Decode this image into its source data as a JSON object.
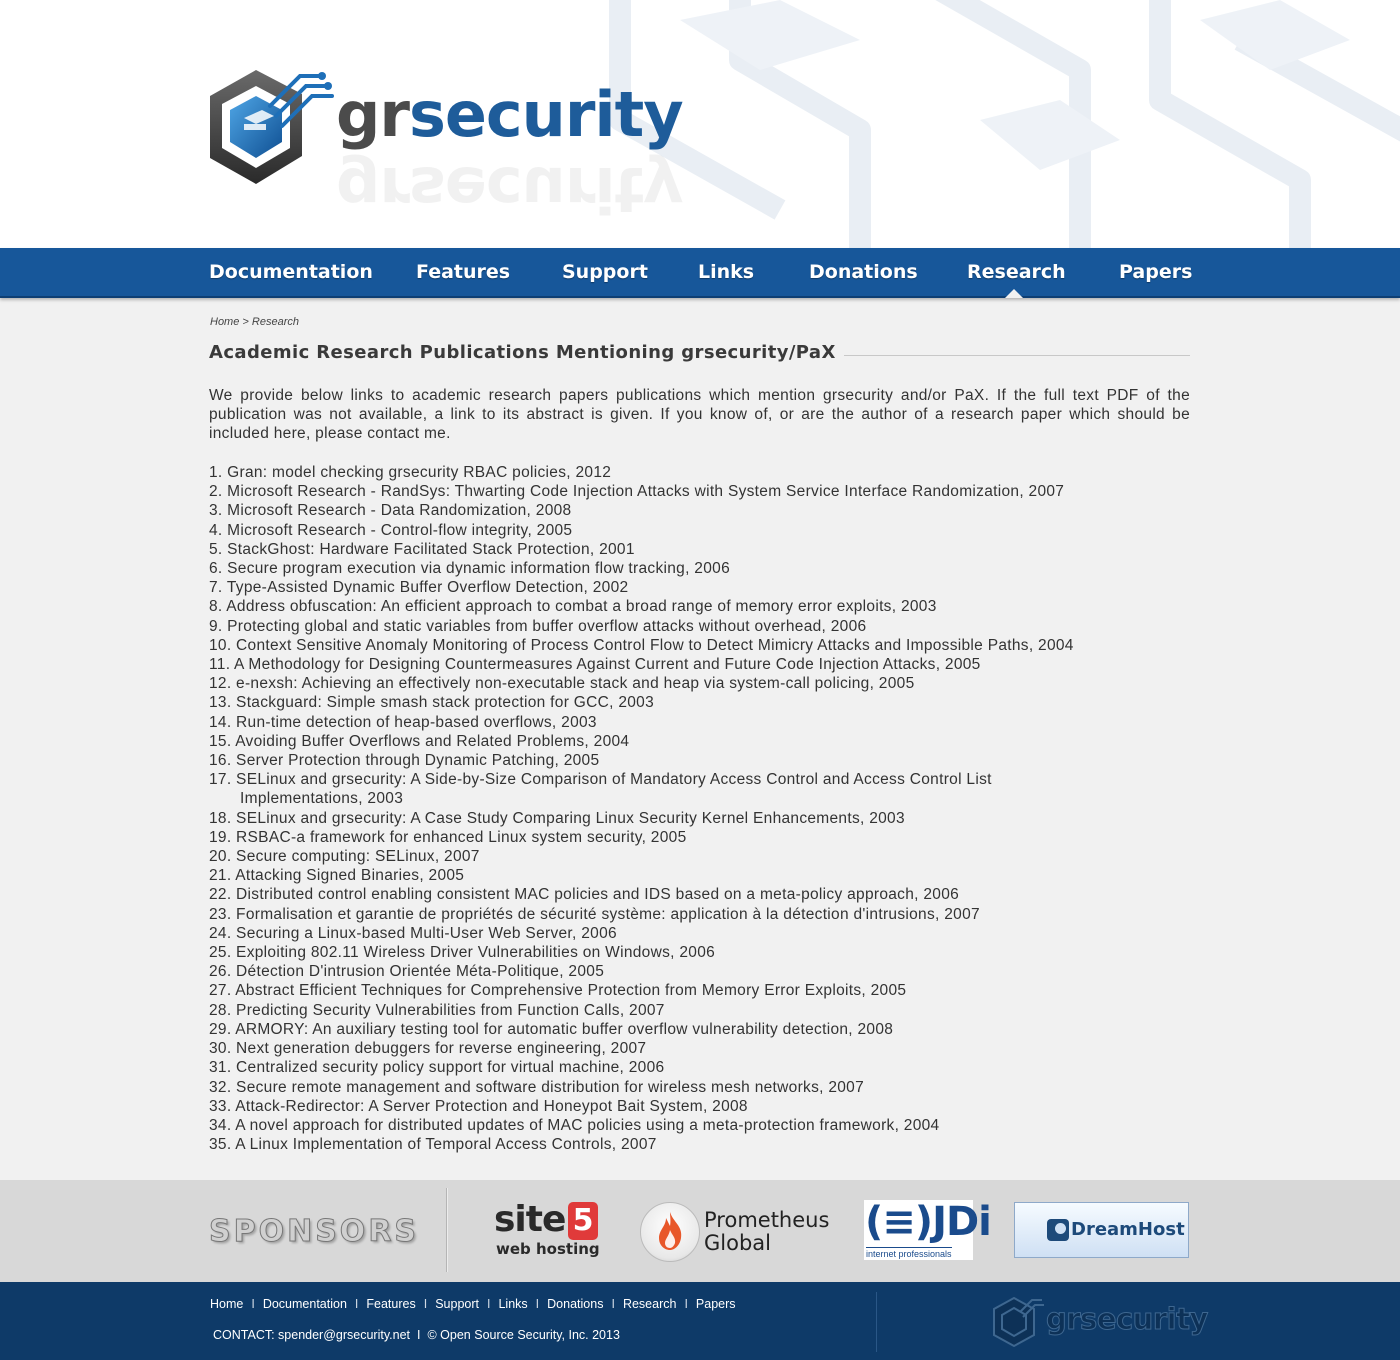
{
  "brand": {
    "name_part1": "gr",
    "name_part2": "security"
  },
  "nav": {
    "items": [
      {
        "label": "Documentation",
        "active": false
      },
      {
        "label": "Features",
        "active": false
      },
      {
        "label": "Support",
        "active": false
      },
      {
        "label": "Links",
        "active": false
      },
      {
        "label": "Donations",
        "active": false
      },
      {
        "label": "Research",
        "active": true
      },
      {
        "label": "Papers",
        "active": false
      }
    ]
  },
  "breadcrumb": {
    "home": "Home",
    "separator": ">",
    "current": "Research"
  },
  "page": {
    "title": "Academic Research Publications Mentioning grsecurity/PaX",
    "intro": "We provide below links to academic research papers publications which mention grsecurity and/or PaX. If the full text PDF of the publication was not available, a link to its abstract is given. If you know of, or are the author of a research paper which should be included here, please contact me."
  },
  "publications": [
    "1. Gran: model checking grsecurity RBAC policies, 2012",
    "2. Microsoft Research - RandSys: Thwarting Code Injection Attacks with System Service Interface Randomization, 2007",
    "3. Microsoft Research - Data Randomization, 2008",
    "4. Microsoft Research - Control-flow integrity, 2005",
    "5. StackGhost: Hardware Facilitated Stack Protection, 2001",
    "6. Secure program execution via dynamic information flow tracking, 2006",
    "7. Type-Assisted Dynamic Buffer Overflow Detection, 2002",
    "8. Address obfuscation: An efficient approach to combat a broad range of memory error exploits, 2003",
    "9. Protecting global and static variables from buffer overflow attacks without overhead, 2006",
    "10. Context Sensitive Anomaly Monitoring of Process Control Flow to Detect Mimicry Attacks and Impossible Paths, 2004",
    "11. A Methodology for Designing Countermeasures Against Current and Future Code Injection Attacks, 2005",
    "12. e-nexsh: Achieving an effectively non-executable stack and heap via system-call policing, 2005",
    "13. Stackguard: Simple smash stack protection for GCC, 2003",
    "14. Run-time detection of heap-based overflows, 2003",
    "15. Avoiding Buffer Overflows and Related Problems, 2004",
    "16. Server Protection through Dynamic Patching, 2005",
    "17. SELinux and grsecurity: A Side-by-Size Comparison of Mandatory Access Control and Access Control List Implementations, 2003",
    "18. SELinux and grsecurity: A Case Study Comparing Linux Security Kernel Enhancements, 2003",
    "19. RSBAC-a framework for enhanced Linux system security, 2005",
    "20. Secure computing: SELinux, 2007",
    "21. Attacking Signed Binaries, 2005",
    "22. Distributed control enabling consistent MAC policies and IDS based on a meta-policy approach, 2006",
    "23. Formalisation et garantie de propriétés de sécurité système: application à la détection d'intrusions, 2007",
    "24. Securing a Linux-based Multi-User Web Server, 2006",
    "25. Exploiting 802.11 Wireless Driver Vulnerabilities on Windows, 2006",
    "26. Détection D'intrusion Orientée Méta-Politique, 2005",
    "27. Abstract Efficient Techniques for Comprehensive Protection from Memory Error Exploits, 2005",
    "28. Predicting Security Vulnerabilities from Function Calls, 2007",
    "29. ARMORY: An auxiliary testing tool for automatic buffer overflow vulnerability detection, 2008",
    "30. Next generation debuggers for reverse engineering, 2007",
    "31. Centralized security policy support for virtual machine, 2006",
    "32. Secure remote management and software distribution for wireless mesh networks, 2007",
    "33. Attack-Redirector: A Server Protection and Honeypot Bait System, 2008",
    "34. A novel approach for distributed updates of MAC policies using a meta-protection framework, 2004",
    "35. A Linux Implementation of Temporal Access Controls, 2007"
  ],
  "sponsors": {
    "title": "SPONSORS",
    "site5": {
      "main": "site",
      "number": "5",
      "sub": "web hosting"
    },
    "prometheus": {
      "line1": "Prometheus",
      "line2": "Global"
    },
    "jdi": {
      "mark": "(≡)JDi",
      "tagline": "internet professionals"
    },
    "dreamhost": {
      "name": "DreamHost"
    }
  },
  "footer": {
    "links": [
      "Home",
      "Documentation",
      "Features",
      "Support",
      "Links",
      "Donations",
      "Research",
      "Papers"
    ],
    "separator": "I",
    "contact": "CONTACT: spender@grsecurity.net",
    "copyright": "© Open Source Security, Inc. 2013",
    "logo_text": "grsecurity"
  },
  "colors": {
    "nav_blue": "#17579a",
    "footer_navy": "#0e3a68",
    "brand_blue": "#1e5c9a",
    "page_bg": "#f1f1f1",
    "sponsor_band": "#d8d8d8"
  }
}
